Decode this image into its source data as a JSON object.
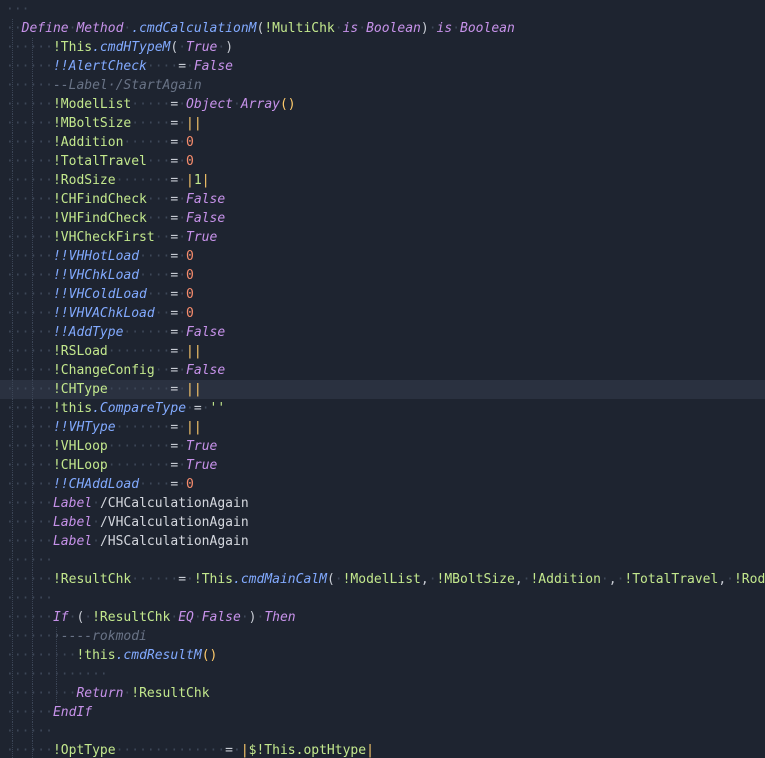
{
  "editor": {
    "lines": [
      {
        "indent": 0,
        "tokens": [
          [
            "ws",
            "···"
          ]
        ]
      },
      {
        "indent": 0,
        "tokens": [
          [
            "ws",
            "··"
          ],
          [
            "kw",
            "Define"
          ],
          [
            "ws",
            "·"
          ],
          [
            "kw",
            "Method"
          ],
          [
            "ws",
            "·"
          ],
          [
            "prop",
            ".cmdCalculationM"
          ],
          [
            "punc",
            "("
          ],
          [
            "var",
            "!MultiChk"
          ],
          [
            "ws",
            "·"
          ],
          [
            "kw",
            "is"
          ],
          [
            "ws",
            "·"
          ],
          [
            "kw",
            "Boolean"
          ],
          [
            "punc",
            ")"
          ],
          [
            "ws",
            "·"
          ],
          [
            "kw",
            "is"
          ],
          [
            "ws",
            "·"
          ],
          [
            "kw",
            "Boolean"
          ]
        ]
      },
      {
        "indent": 1,
        "tokens": [
          [
            "ws",
            "······"
          ],
          [
            "var",
            "!This"
          ],
          [
            "prop",
            ".cmdHTypeM"
          ],
          [
            "punc",
            "("
          ],
          [
            "ws",
            "·"
          ],
          [
            "bool",
            "True"
          ],
          [
            "ws",
            "·"
          ],
          [
            "punc",
            ")"
          ]
        ]
      },
      {
        "indent": 1,
        "tokens": [
          [
            "ws",
            "······"
          ],
          [
            "prop",
            "!!AlertCheck"
          ],
          [
            "ws",
            "····"
          ],
          [
            "punc",
            "="
          ],
          [
            "ws",
            "·"
          ],
          [
            "bool",
            "False"
          ]
        ]
      },
      {
        "indent": 1,
        "tokens": [
          [
            "ws",
            "······"
          ],
          [
            "com",
            "--Label·/StartAgain"
          ]
        ]
      },
      {
        "indent": 1,
        "tokens": [
          [
            "ws",
            "······"
          ],
          [
            "var",
            "!ModelList"
          ],
          [
            "ws",
            "·····"
          ],
          [
            "punc",
            "="
          ],
          [
            "ws",
            "·"
          ],
          [
            "kw",
            "Object"
          ],
          [
            "ws",
            "·"
          ],
          [
            "kw",
            "Array"
          ],
          [
            "pipe",
            "()"
          ]
        ]
      },
      {
        "indent": 1,
        "tokens": [
          [
            "ws",
            "······"
          ],
          [
            "var",
            "!MBoltSize"
          ],
          [
            "ws",
            "·····"
          ],
          [
            "punc",
            "="
          ],
          [
            "ws",
            "·"
          ],
          [
            "pipe",
            "||"
          ]
        ]
      },
      {
        "indent": 1,
        "tokens": [
          [
            "ws",
            "······"
          ],
          [
            "var",
            "!Addition"
          ],
          [
            "ws",
            "······"
          ],
          [
            "punc",
            "="
          ],
          [
            "ws",
            "·"
          ],
          [
            "num",
            "0"
          ]
        ]
      },
      {
        "indent": 1,
        "tokens": [
          [
            "ws",
            "······"
          ],
          [
            "var",
            "!TotalTravel"
          ],
          [
            "ws",
            "···"
          ],
          [
            "punc",
            "="
          ],
          [
            "ws",
            "·"
          ],
          [
            "num",
            "0"
          ]
        ]
      },
      {
        "indent": 1,
        "tokens": [
          [
            "ws",
            "······"
          ],
          [
            "var",
            "!RodSize"
          ],
          [
            "ws",
            "·······"
          ],
          [
            "punc",
            "="
          ],
          [
            "ws",
            "·"
          ],
          [
            "pipe",
            "|"
          ],
          [
            "str",
            "1"
          ],
          [
            "pipe",
            "|"
          ]
        ]
      },
      {
        "indent": 1,
        "tokens": [
          [
            "ws",
            "······"
          ],
          [
            "var",
            "!CHFindCheck"
          ],
          [
            "ws",
            "···"
          ],
          [
            "punc",
            "="
          ],
          [
            "ws",
            "·"
          ],
          [
            "bool",
            "False"
          ]
        ]
      },
      {
        "indent": 1,
        "tokens": [
          [
            "ws",
            "······"
          ],
          [
            "var",
            "!VHFindCheck"
          ],
          [
            "ws",
            "···"
          ],
          [
            "punc",
            "="
          ],
          [
            "ws",
            "·"
          ],
          [
            "bool",
            "False"
          ]
        ]
      },
      {
        "indent": 1,
        "tokens": [
          [
            "ws",
            "······"
          ],
          [
            "var",
            "!VHCheckFirst"
          ],
          [
            "ws",
            "··"
          ],
          [
            "punc",
            "="
          ],
          [
            "ws",
            "·"
          ],
          [
            "bool",
            "True"
          ]
        ]
      },
      {
        "indent": 1,
        "tokens": [
          [
            "ws",
            "······"
          ],
          [
            "prop",
            "!!VHHotLoad"
          ],
          [
            "ws",
            "····"
          ],
          [
            "punc",
            "="
          ],
          [
            "ws",
            "·"
          ],
          [
            "num",
            "0"
          ]
        ]
      },
      {
        "indent": 1,
        "tokens": [
          [
            "ws",
            "······"
          ],
          [
            "prop",
            "!!VHChkLoad"
          ],
          [
            "ws",
            "····"
          ],
          [
            "punc",
            "="
          ],
          [
            "ws",
            "·"
          ],
          [
            "num",
            "0"
          ]
        ]
      },
      {
        "indent": 1,
        "tokens": [
          [
            "ws",
            "······"
          ],
          [
            "prop",
            "!!VHColdLoad"
          ],
          [
            "ws",
            "···"
          ],
          [
            "punc",
            "="
          ],
          [
            "ws",
            "·"
          ],
          [
            "num",
            "0"
          ]
        ]
      },
      {
        "indent": 1,
        "tokens": [
          [
            "ws",
            "······"
          ],
          [
            "prop",
            "!!VHVAChkLoad"
          ],
          [
            "ws",
            "··"
          ],
          [
            "punc",
            "="
          ],
          [
            "ws",
            "·"
          ],
          [
            "num",
            "0"
          ]
        ]
      },
      {
        "indent": 1,
        "tokens": [
          [
            "ws",
            "······"
          ],
          [
            "prop",
            "!!AddType"
          ],
          [
            "ws",
            "······"
          ],
          [
            "punc",
            "="
          ],
          [
            "ws",
            "·"
          ],
          [
            "bool",
            "False"
          ]
        ]
      },
      {
        "indent": 1,
        "tokens": [
          [
            "ws",
            "······"
          ],
          [
            "var",
            "!RSLoad"
          ],
          [
            "ws",
            "········"
          ],
          [
            "punc",
            "="
          ],
          [
            "ws",
            "·"
          ],
          [
            "pipe",
            "||"
          ]
        ]
      },
      {
        "indent": 1,
        "tokens": [
          [
            "ws",
            "······"
          ],
          [
            "var",
            "!ChangeConfig"
          ],
          [
            "ws",
            "··"
          ],
          [
            "punc",
            "="
          ],
          [
            "ws",
            "·"
          ],
          [
            "bool",
            "False"
          ]
        ]
      },
      {
        "indent": 1,
        "current": true,
        "tokens": [
          [
            "ws",
            "······"
          ],
          [
            "var",
            "!CHType"
          ],
          [
            "ws",
            "········"
          ],
          [
            "punc",
            "="
          ],
          [
            "ws",
            "·"
          ],
          [
            "pipe",
            "||"
          ]
        ]
      },
      {
        "indent": 1,
        "tokens": [
          [
            "ws",
            "······"
          ],
          [
            "var",
            "!this"
          ],
          [
            "prop",
            ".CompareType"
          ],
          [
            "ws",
            "·"
          ],
          [
            "punc",
            "="
          ],
          [
            "ws",
            "·"
          ],
          [
            "str",
            "''"
          ]
        ]
      },
      {
        "indent": 1,
        "tokens": [
          [
            "ws",
            "······"
          ],
          [
            "prop",
            "!!VHType"
          ],
          [
            "ws",
            "·······"
          ],
          [
            "punc",
            "="
          ],
          [
            "ws",
            "·"
          ],
          [
            "pipe",
            "||"
          ]
        ]
      },
      {
        "indent": 1,
        "tokens": [
          [
            "ws",
            "······"
          ],
          [
            "var",
            "!VHLoop"
          ],
          [
            "ws",
            "········"
          ],
          [
            "punc",
            "="
          ],
          [
            "ws",
            "·"
          ],
          [
            "bool",
            "True"
          ]
        ]
      },
      {
        "indent": 1,
        "tokens": [
          [
            "ws",
            "······"
          ],
          [
            "var",
            "!CHLoop"
          ],
          [
            "ws",
            "········"
          ],
          [
            "punc",
            "="
          ],
          [
            "ws",
            "·"
          ],
          [
            "bool",
            "True"
          ]
        ]
      },
      {
        "indent": 1,
        "tokens": [
          [
            "ws",
            "······"
          ],
          [
            "prop",
            "!!CHAddLoad"
          ],
          [
            "ws",
            "····"
          ],
          [
            "punc",
            "="
          ],
          [
            "ws",
            "·"
          ],
          [
            "num",
            "0"
          ]
        ]
      },
      {
        "indent": 1,
        "tokens": [
          [
            "ws",
            "······"
          ],
          [
            "kw",
            "Label"
          ],
          [
            "ws",
            "·"
          ],
          [
            "plain",
            "/CHCalculationAgain"
          ]
        ]
      },
      {
        "indent": 1,
        "tokens": [
          [
            "ws",
            "······"
          ],
          [
            "kw",
            "Label"
          ],
          [
            "ws",
            "·"
          ],
          [
            "plain",
            "/VHCalculationAgain"
          ]
        ]
      },
      {
        "indent": 1,
        "tokens": [
          [
            "ws",
            "······"
          ],
          [
            "kw",
            "Label"
          ],
          [
            "ws",
            "·"
          ],
          [
            "plain",
            "/HSCalculationAgain"
          ]
        ]
      },
      {
        "indent": 1,
        "tokens": [
          [
            "ws",
            "······"
          ]
        ]
      },
      {
        "indent": 1,
        "tokens": [
          [
            "ws",
            "······"
          ],
          [
            "var",
            "!ResultChk"
          ],
          [
            "ws",
            "······"
          ],
          [
            "punc",
            "="
          ],
          [
            "ws",
            "·"
          ],
          [
            "var",
            "!This"
          ],
          [
            "prop",
            ".cmdMainCalM"
          ],
          [
            "punc",
            "("
          ],
          [
            "ws",
            "·"
          ],
          [
            "var",
            "!ModelList"
          ],
          [
            "punc",
            ","
          ],
          [
            "ws",
            "·"
          ],
          [
            "var",
            "!MBoltSize"
          ],
          [
            "punc",
            ","
          ],
          [
            "ws",
            "·"
          ],
          [
            "var",
            "!Addition"
          ],
          [
            "ws",
            "·"
          ],
          [
            "punc",
            ","
          ],
          [
            "ws",
            "·"
          ],
          [
            "var",
            "!TotalTravel"
          ],
          [
            "punc",
            ","
          ],
          [
            "ws",
            "·"
          ],
          [
            "var",
            "!RodSize"
          ]
        ]
      },
      {
        "indent": 1,
        "tokens": [
          [
            "ws",
            "······"
          ]
        ]
      },
      {
        "indent": 1,
        "tokens": [
          [
            "ws",
            "······"
          ],
          [
            "kw",
            "If"
          ],
          [
            "ws",
            "·"
          ],
          [
            "punc",
            "("
          ],
          [
            "ws",
            "·"
          ],
          [
            "var",
            "!ResultChk"
          ],
          [
            "ws",
            "·"
          ],
          [
            "kw",
            "EQ"
          ],
          [
            "ws",
            "·"
          ],
          [
            "bool",
            "False"
          ],
          [
            "ws",
            "·"
          ],
          [
            "punc",
            ")"
          ],
          [
            "ws",
            "·"
          ],
          [
            "kw",
            "Then"
          ]
        ]
      },
      {
        "indent": 2,
        "tokens": [
          [
            "ws",
            "······"
          ],
          [
            "com",
            "·----rokmodi"
          ]
        ]
      },
      {
        "indent": 2,
        "tokens": [
          [
            "ws",
            "······"
          ],
          [
            "ws",
            "···"
          ],
          [
            "var",
            "!this"
          ],
          [
            "prop",
            ".cmdResultM"
          ],
          [
            "pipe",
            "()"
          ]
        ]
      },
      {
        "indent": 2,
        "tokens": [
          [
            "ws",
            "······"
          ],
          [
            "ws",
            "·······"
          ]
        ]
      },
      {
        "indent": 2,
        "tokens": [
          [
            "ws",
            "······"
          ],
          [
            "ws",
            "···"
          ],
          [
            "kw",
            "Return"
          ],
          [
            "ws",
            "·"
          ],
          [
            "var",
            "!ResultChk"
          ]
        ]
      },
      {
        "indent": 1,
        "tokens": [
          [
            "ws",
            "······"
          ],
          [
            "kw",
            "EndIf"
          ]
        ]
      },
      {
        "indent": 1,
        "tokens": [
          [
            "ws",
            "······"
          ]
        ]
      },
      {
        "indent": 1,
        "tokens": [
          [
            "ws",
            "······"
          ],
          [
            "var",
            "!OptType"
          ],
          [
            "ws",
            "··············"
          ],
          [
            "punc",
            "="
          ],
          [
            "ws",
            "·"
          ],
          [
            "pipe",
            "|"
          ],
          [
            "var",
            "$!This.optHtype"
          ],
          [
            "pipe",
            "|"
          ]
        ]
      }
    ]
  },
  "colors": {
    "background": "#1e2430",
    "current_line": "#2a3140",
    "keyword": "#c792ea",
    "variable": "#c3e88d",
    "property": "#82aaff",
    "number": "#f78c6c",
    "pipe": "#ffcb6b"
  }
}
